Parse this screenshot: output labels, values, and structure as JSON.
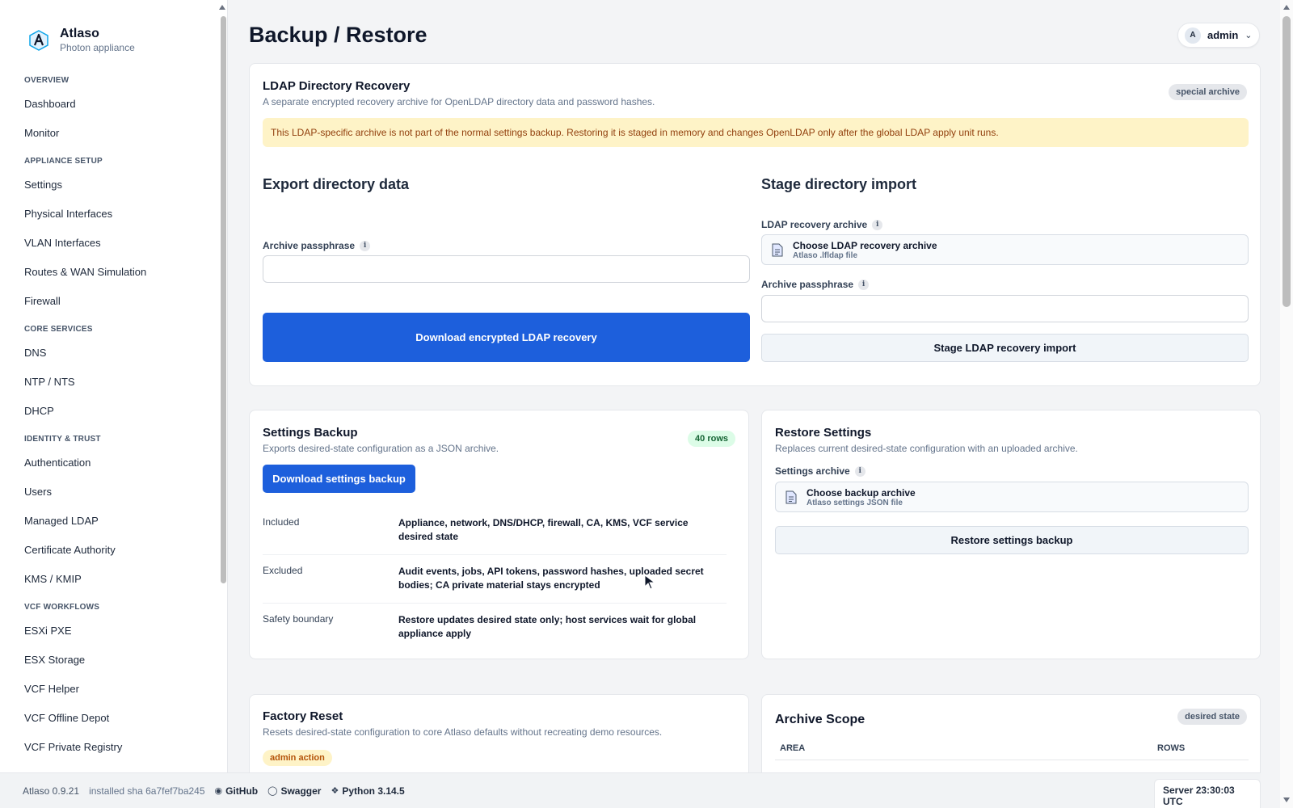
{
  "app": {
    "name": "Atlaso",
    "subtitle": "Photon appliance",
    "page_title": "Backup / Restore"
  },
  "user": {
    "avatar_letter": "A",
    "name": "admin"
  },
  "sidebar": {
    "sections": [
      {
        "title": "OVERVIEW",
        "items": [
          "Dashboard",
          "Monitor"
        ]
      },
      {
        "title": "APPLIANCE SETUP",
        "items": [
          "Settings",
          "Physical Interfaces",
          "VLAN Interfaces",
          "Routes & WAN Simulation",
          "Firewall"
        ]
      },
      {
        "title": "CORE SERVICES",
        "items": [
          "DNS",
          "NTP / NTS",
          "DHCP"
        ]
      },
      {
        "title": "IDENTITY & TRUST",
        "items": [
          "Authentication",
          "Users",
          "Managed LDAP",
          "Certificate Authority",
          "KMS / KMIP"
        ]
      },
      {
        "title": "VCF WORKFLOWS",
        "items": [
          "ESXi PXE",
          "ESX Storage",
          "VCF Helper",
          "VCF Offline Depot",
          "VCF Private Registry"
        ]
      }
    ]
  },
  "ldap": {
    "title": "LDAP Directory Recovery",
    "subtitle": "A separate encrypted recovery archive for OpenLDAP directory data and password hashes.",
    "badge": "special archive",
    "warning": "This LDAP-specific archive is not part of the normal settings backup. Restoring it is staged in memory and changes OpenLDAP only after the global LDAP apply unit runs.",
    "export": {
      "heading": "Export directory data",
      "passphrase_label": "Archive passphrase",
      "passphrase_value": "",
      "button": "Download encrypted LDAP recovery"
    },
    "import": {
      "heading": "Stage directory import",
      "archive_label": "LDAP recovery archive",
      "file_title": "Choose LDAP recovery archive",
      "file_sub": "Atlaso .lfldap file",
      "passphrase_label": "Archive passphrase",
      "passphrase_value": "",
      "button": "Stage LDAP recovery import"
    }
  },
  "settings_backup": {
    "title": "Settings Backup",
    "subtitle": "Exports desired-state configuration as a JSON archive.",
    "badge": "40 rows",
    "button": "Download settings backup",
    "rows": [
      {
        "key": "Included",
        "value": "Appliance, network, DNS/DHCP, firewall, CA, KMS, VCF service desired state"
      },
      {
        "key": "Excluded",
        "value": "Audit events, jobs, API tokens, password hashes, uploaded secret bodies; CA private material stays encrypted"
      },
      {
        "key": "Safety boundary",
        "value": "Restore updates desired state only; host services wait for global appliance apply"
      }
    ]
  },
  "restore": {
    "title": "Restore Settings",
    "subtitle": "Replaces current desired-state configuration with an uploaded archive.",
    "archive_label": "Settings archive",
    "file_title": "Choose backup archive",
    "file_sub": "Atlaso settings JSON file",
    "button": "Restore settings backup"
  },
  "factory": {
    "title": "Factory Reset",
    "subtitle": "Resets desired-state configuration to core Atlaso defaults without recreating demo resources.",
    "badge": "admin action"
  },
  "scope": {
    "title": "Archive Scope",
    "badge": "desired state",
    "col_area": "AREA",
    "col_rows": "ROWS"
  },
  "footer": {
    "version": "Atlaso 0.9.21",
    "sha": "installed sha 6a7fef7ba245",
    "github": "GitHub",
    "swagger": "Swagger",
    "python": "Python 3.14.5",
    "server_time": "Server 23:30:03 UTC"
  },
  "colors": {
    "primary": "#1d5fdc",
    "warning_bg": "#fef3c7",
    "warning_text": "#92400e",
    "success_bg": "#dcfce7"
  },
  "icons": {
    "logo": "atlaso-logo-icon",
    "info": "info-icon",
    "file": "file-icon",
    "chevron": "chevron-down-icon",
    "github": "github-icon",
    "swagger": "swagger-icon",
    "python": "python-icon"
  }
}
